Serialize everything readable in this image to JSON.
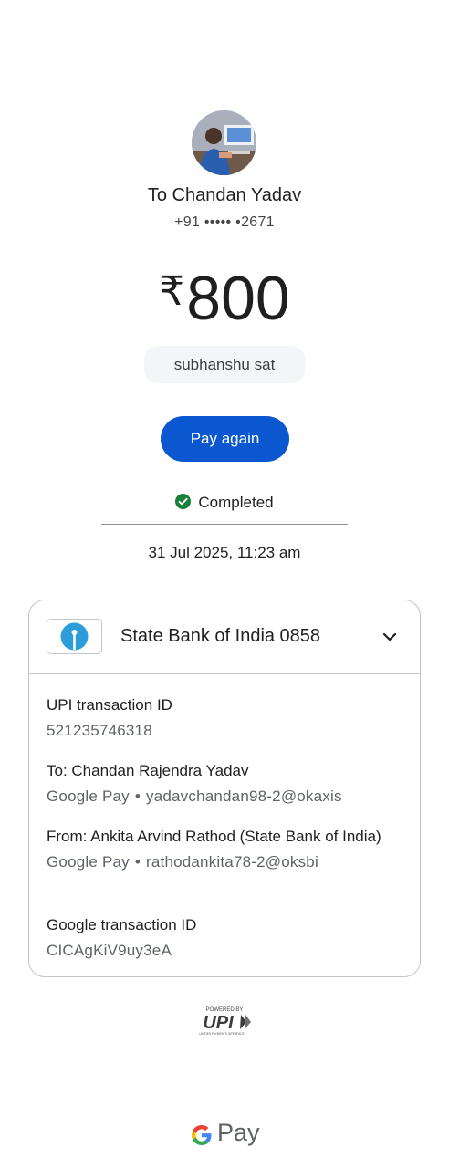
{
  "payee": {
    "name": "To Chandan Yadav",
    "phone": "+91 ••••• •2671"
  },
  "amount": {
    "currency": "₹",
    "value": "800"
  },
  "note": "subhanshu sat",
  "actions": {
    "pay_again_label": "Pay again"
  },
  "status": {
    "text": "Completed",
    "icon": "check-circle-icon",
    "color": "#188038"
  },
  "datetime": "31 Jul 2025, 11:23 am",
  "bank": {
    "name": "State Bank of India 0858",
    "logo": "sbi-logo"
  },
  "details": {
    "upi_txn": {
      "label": "UPI transaction ID",
      "value": "521235746318"
    },
    "to": {
      "label": "To: Chandan Rajendra Yadav",
      "app": "Google Pay",
      "handle": "yadavchandan98-2@okaxis"
    },
    "from": {
      "label": "From: Ankita Arvind Rathod (State Bank of India)",
      "app": "Google Pay",
      "handle": "rathodankita78-2@oksbi"
    },
    "google_txn": {
      "label": "Google transaction ID",
      "value": "CICAgKiV9uy3eA"
    }
  },
  "footer": {
    "upi_powered": "POWERED BY",
    "upi_brand": "UPI",
    "upi_tagline": "UNIFIED PAYMENTS INTERFACE",
    "gpay_text": "Pay"
  },
  "colors": {
    "primary": "#0b57d0",
    "success": "#188038",
    "sbi": "#2d9cdb"
  }
}
